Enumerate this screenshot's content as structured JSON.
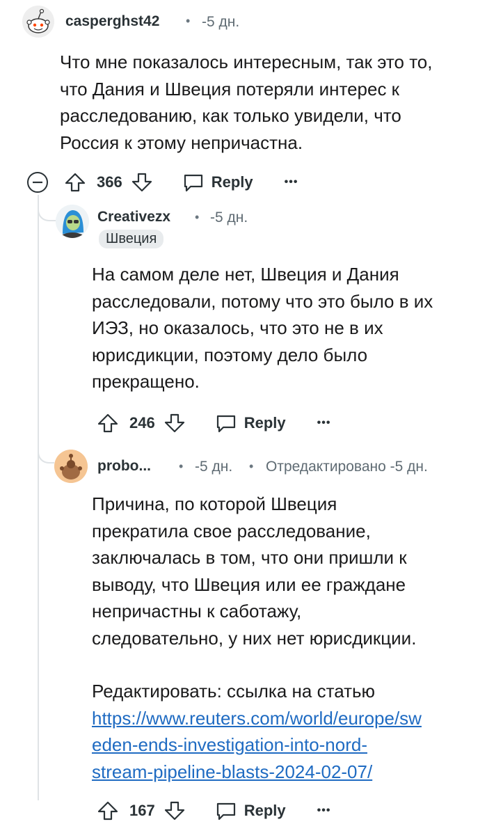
{
  "comments": [
    {
      "username": "casperghst42",
      "time": "-5 дн.",
      "body": [
        "Что мне показалось интересным, так это то,",
        "что Дания и Швеция потеряли интерес к",
        "расследованию, как только увидели, что",
        "Россия к этому непричастна."
      ],
      "votes": "366",
      "reply_label": "Reply",
      "more_label": "•••"
    },
    {
      "username": "Creativezx",
      "time": "-5 дн.",
      "flair": "Швеция",
      "body": [
        "На самом деле нет, Швеция и Дания",
        "расследовали, потому что это было в их",
        "ИЭЗ, но оказалось, что это не в их",
        "юрисдикции, поэтому дело было",
        "прекращено."
      ],
      "votes": "246",
      "reply_label": "Reply",
      "more_label": "•••"
    },
    {
      "username": "probo...",
      "time": "-5 дн.",
      "edited": "Отредактировано -5 дн.",
      "body": [
        "Причина, по которой Швеция",
        "прекратила свое расследование,",
        "заключалась в том, что они пришли к",
        "выводу, что Швеция или ее граждане",
        "непричастны к саботажу,",
        "следовательно, у них нет юрисдикции."
      ],
      "edit_label": "Редактировать: ссылка на статью",
      "link_lines": [
        "https://www.reuters.com/world/europe/sw",
        "eden-ends-investigation-into-nord-",
        "stream-pipeline-blasts-2024-02-07/"
      ],
      "votes": "167",
      "reply_label": "Reply",
      "more_label": "•••"
    }
  ],
  "colors": {
    "link": "#1f6bc2",
    "thread_line": "#dfe3e6",
    "flair_bg": "#e8ebed"
  }
}
